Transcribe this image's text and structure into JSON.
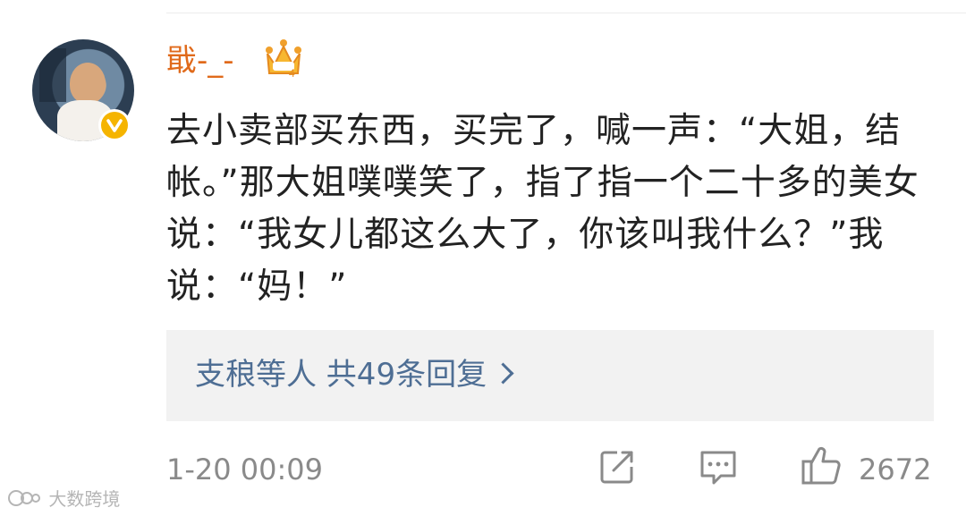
{
  "post": {
    "username": "戢-_-",
    "comment_text": "去小卖部买东西，买完了，喊一声：“大姐，结帐。”那大姐噗噗笑了，指了指一个二十多的美女说：“我女儿都这么大了，你该叫我什么？”我说：“妈！”",
    "timestamp": "1-20 00:09",
    "like_count": "2672"
  },
  "replies": {
    "label": "支稂等人 共49条回复"
  },
  "icons": {
    "crown": "crown-badge-icon",
    "verified": "verified-badge-icon",
    "repost": "repost-icon",
    "comment": "comment-icon",
    "like": "thumbs-up-icon"
  },
  "watermark": {
    "text": "大数跨境"
  },
  "colors": {
    "username": "#e06a1b",
    "link": "#4e6e94",
    "meta_gray": "#8a8a8a",
    "verified_badge": "#f5b400"
  }
}
